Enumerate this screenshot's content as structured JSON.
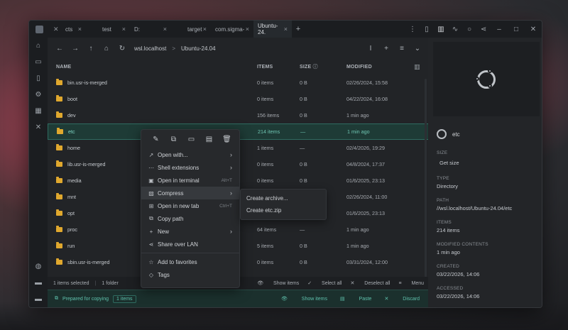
{
  "tabs": [
    {
      "label": "cts",
      "icon": "wrench-icon",
      "active": false
    },
    {
      "label": "test",
      "icon": "",
      "active": false
    },
    {
      "label": "D:",
      "icon": "",
      "active": false
    },
    {
      "label": "target",
      "icon": "",
      "active": false
    },
    {
      "label": "com.sigma-",
      "icon": "",
      "active": false
    },
    {
      "label": "Ubuntu-24.",
      "icon": "",
      "active": true
    }
  ],
  "toolbar": {
    "address_parts": [
      "wsl.localhost",
      "Ubuntu-24.04"
    ],
    "separator": ">"
  },
  "table": {
    "headers": {
      "name": "NAME",
      "items": "ITEMS",
      "size": "SIZE",
      "modified": "MODIFIED"
    },
    "rows": [
      {
        "name": "bin.usr-is-merged",
        "items": "0 items",
        "size": "0 B",
        "modified": "02/26/2024, 15:58"
      },
      {
        "name": "boot",
        "items": "0 items",
        "size": "0 B",
        "modified": "04/22/2024, 16:08"
      },
      {
        "name": "dev",
        "items": "156 items",
        "size": "0 B",
        "modified": "1 min ago"
      },
      {
        "name": "etc",
        "items": "214 items",
        "size": "—",
        "modified": "1 min ago",
        "selected": true
      },
      {
        "name": "home",
        "items": "1 items",
        "size": "—",
        "modified": "02/4/2026, 19:29"
      },
      {
        "name": "lib.usr-is-merged",
        "items": "0 items",
        "size": "0 B",
        "modified": "04/8/2024, 17:37"
      },
      {
        "name": "media",
        "items": "0 items",
        "size": "0 B",
        "modified": "01/6/2025, 23:13"
      },
      {
        "name": "mnt",
        "items": "",
        "size": "",
        "modified": "02/26/2024, 11:00"
      },
      {
        "name": "opt",
        "items": "",
        "size": "",
        "modified": "01/6/2025, 23:13"
      },
      {
        "name": "proc",
        "items": "64 items",
        "size": "—",
        "modified": "1 min ago"
      },
      {
        "name": "run",
        "items": "5 items",
        "size": "0 B",
        "modified": "1 min ago"
      },
      {
        "name": "sbin.usr-is-merged",
        "items": "0 items",
        "size": "0 B",
        "modified": "03/31/2024, 12:00"
      }
    ]
  },
  "status": {
    "selected": "1 items selected",
    "folders": "1 folder",
    "show_items": "Show items",
    "select_all": "Select all",
    "deselect_all": "Deselect all",
    "menu": "Menu"
  },
  "clipboard": {
    "message": "Prepared for copying",
    "count": "1 items",
    "show_items": "Show items",
    "paste": "Paste",
    "discard": "Discard"
  },
  "context_menu": {
    "items": [
      {
        "label": "Open with...",
        "icon": "open-with-icon",
        "submenu": true
      },
      {
        "label": "Shell extensions",
        "icon": "dots-icon",
        "submenu": true
      },
      {
        "label": "Open in terminal",
        "icon": "terminal-icon",
        "shortcut": "Alt+T"
      },
      {
        "label": "Compress",
        "icon": "compress-icon",
        "submenu": true,
        "hover": true
      },
      {
        "label": "Open in new tab",
        "icon": "new-tab-icon",
        "shortcut": "Ctrl+T"
      },
      {
        "label": "Copy path",
        "icon": "copy-path-icon"
      },
      {
        "label": "New",
        "icon": "plus-icon",
        "submenu": true
      },
      {
        "label": "Share over LAN",
        "icon": "share-icon"
      },
      {
        "label": "Add to favorites",
        "icon": "star-icon"
      },
      {
        "label": "Tags",
        "icon": "tag-icon"
      }
    ]
  },
  "submenu": {
    "items": [
      "Create archive...",
      "Create etc.zip"
    ]
  },
  "details": {
    "name": "etc",
    "size_label": "SIZE",
    "size_value": "Get size",
    "type_label": "TYPE",
    "type_value": "Directory",
    "path_label": "PATH",
    "path_value": "//wsl.localhost/Ubuntu-24.04/etc",
    "items_label": "ITEMS",
    "items_value": "214 items",
    "modified_contents_label": "MODIFIED CONTENTS",
    "modified_contents_value": "1 min ago",
    "created_label": "CREATED",
    "created_value": "03/22/2026, 14:06",
    "accessed_label": "ACCESSED",
    "accessed_value": "03/22/2026, 14:06"
  },
  "colors": {
    "accent": "#5fc2ad",
    "folder": "#e0a82e",
    "selection_bg": "#1e3b36"
  }
}
